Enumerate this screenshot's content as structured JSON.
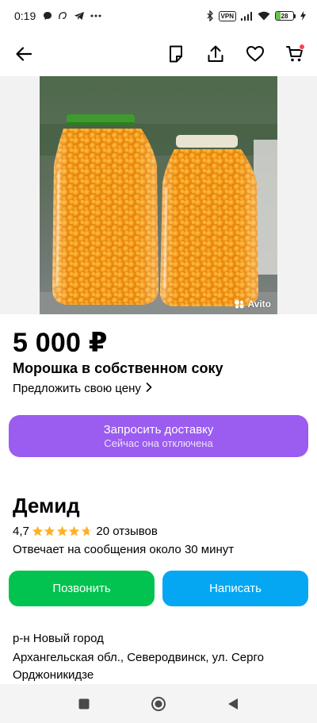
{
  "status_bar": {
    "time": "0:19",
    "vpn": "VPN",
    "battery_level": "28",
    "battery_fill": 0.28,
    "icons_left": [
      "chat-bubble-icon",
      "a-app-icon",
      "telegram-icon",
      "more-dots-icon"
    ],
    "icons_right": [
      "bluetooth-icon",
      "vpn-badge",
      "signal-icon",
      "wifi-icon",
      "battery-icon",
      "charging-bolt-icon"
    ]
  },
  "app_bar": {
    "icons": [
      "back-arrow-icon",
      "note-icon",
      "share-icon",
      "heart-icon",
      "cart-icon"
    ],
    "cart_badge_color": "#ff4053"
  },
  "listing": {
    "image_watermark": "Avito",
    "price": "5 000 ₽",
    "title": "Морошка в собственном соку",
    "offer_price_link": "Предложить свою цену",
    "delivery_button": {
      "label": "Запросить доставку",
      "sublabel": "Сейчас она отключена",
      "color": "#9b5cf0"
    }
  },
  "seller": {
    "name": "Демид",
    "rating": "4,7",
    "rating_value": 4.7,
    "reviews": "20 отзывов",
    "response_time": "Отвечает на сообщения около 30 минут",
    "call_button": "Позвонить",
    "write_button": "Написать",
    "call_color": "#02c34f",
    "write_color": "#05a7f2",
    "star_color": "#ffb021"
  },
  "location": {
    "district": "р-н Новый город",
    "address": "Архангельская обл., Северодвинск, ул. Серго Орджоникидзе"
  },
  "nav_bar": {
    "icons": [
      "recents-square-icon",
      "home-circle-icon",
      "back-triangle-icon"
    ]
  }
}
